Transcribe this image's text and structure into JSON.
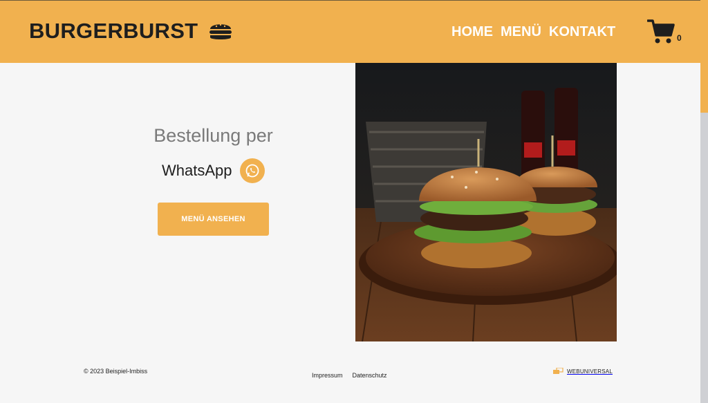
{
  "header": {
    "logo_text": "BURGERBURST",
    "logo_icon": "burger-icon",
    "nav": [
      "HOME",
      "MENÜ",
      "KONTAKT"
    ],
    "cart_count": "0",
    "cart_icon": "shopping-cart-icon"
  },
  "hero": {
    "line1": "Bestellung per",
    "line2": "WhatsApp",
    "whatsapp_icon": "whatsapp-icon",
    "button_label": "MENÜ ANSEHEN"
  },
  "footer": {
    "copyright": "© 2023 Beispiel-Imbiss",
    "links": [
      "Impressum",
      "Datenschutz"
    ],
    "brand": "WEBUNIVERSAL",
    "brand_icon": "webuniversal-logo-icon"
  },
  "colors": {
    "accent": "#f1b14f",
    "background": "#f6f6f6",
    "text_dark": "#1e1e1e",
    "text_muted": "#7a7a7a"
  }
}
